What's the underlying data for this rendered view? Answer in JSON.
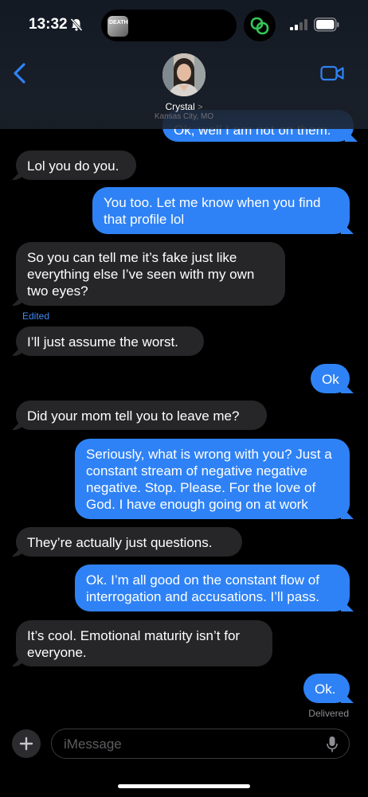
{
  "status_bar": {
    "time": "13:32"
  },
  "island": {
    "thumb_text": "DEATH"
  },
  "contact": {
    "name": "Crystal",
    "chevron": ">",
    "location": "Kansas City, MO"
  },
  "messages": [
    {
      "sender": "me",
      "text": "Ok, well I am not on them."
    },
    {
      "sender": "them",
      "text": "Lol you do you."
    },
    {
      "sender": "me",
      "text": "You too. Let me know when you find that profile lol"
    },
    {
      "sender": "them",
      "text": "So you can tell me it’s fake just like everything else I’ve seen with my own two eyes?"
    },
    {
      "sender": "them",
      "text": "I’ll just assume the worst.",
      "label": "Edited"
    },
    {
      "sender": "me",
      "text": "Ok"
    },
    {
      "sender": "them",
      "text": "Did your mom tell you to leave me?"
    },
    {
      "sender": "me",
      "text": "Seriously, what is wrong with you? Just a constant stream of negative negative negative. Stop. Please. For the love of God. I have enough going on at work"
    },
    {
      "sender": "them",
      "text": "They’re actually just questions."
    },
    {
      "sender": "me",
      "text": "Ok. I’m all good on the constant flow of interrogation and accusations. I’ll pass."
    },
    {
      "sender": "them",
      "text": "It’s cool. Emotional maturity isn’t for everyone."
    },
    {
      "sender": "me",
      "text": "Ok.",
      "status": "Delivered"
    }
  ],
  "compose": {
    "plus_label": "+",
    "placeholder": "iMessage"
  },
  "colors": {
    "outgoing": "#2f82f5",
    "incoming": "#262628",
    "accent": "#3d8bf5",
    "background": "#000000"
  },
  "icons": [
    "bell-slash-icon",
    "link-icon",
    "signal-icon",
    "battery-icon",
    "back-chevron-icon",
    "video-camera-icon",
    "plus-icon",
    "microphone-icon"
  ]
}
